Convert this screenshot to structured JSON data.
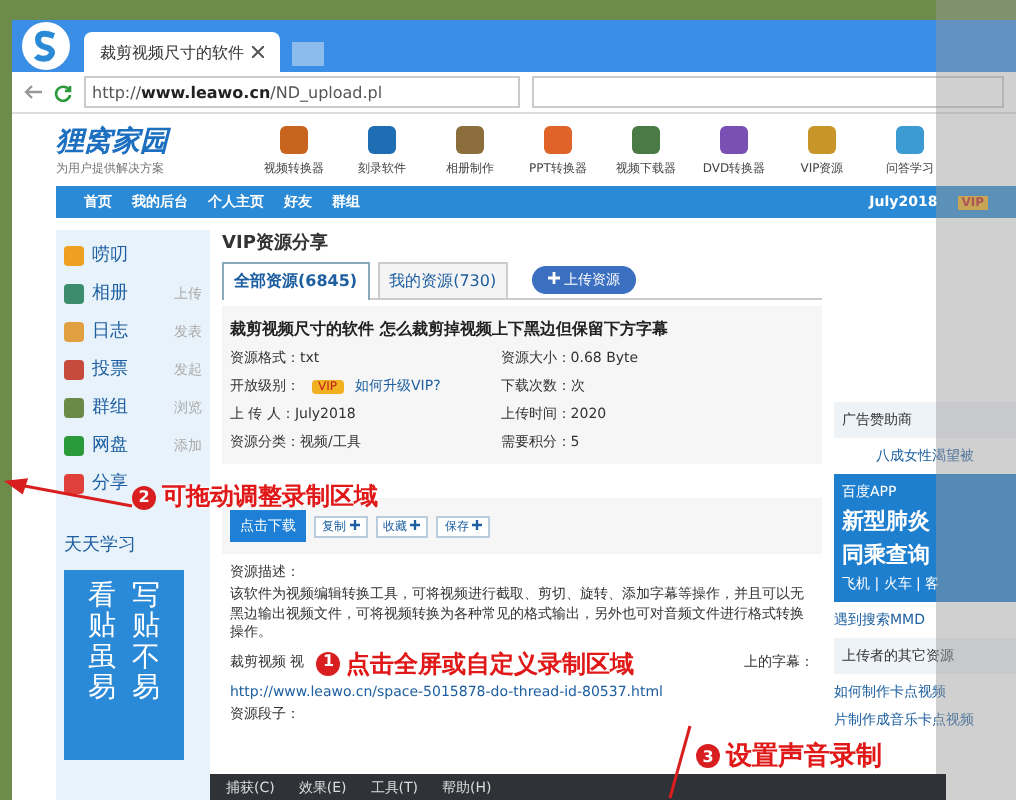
{
  "browser": {
    "tab_title": "裁剪视频尺寸的软件",
    "url_prefix": "http://",
    "url_domain": "www.leawo.cn",
    "url_path": "/ND_upload.pl"
  },
  "site": {
    "logo_title": "狸窝家园",
    "logo_tagline": "为用户提供解决方案",
    "nav_icons": [
      {
        "label": "视频转换器",
        "color": "#c8641e"
      },
      {
        "label": "刻录软件",
        "color": "#1e6eb4"
      },
      {
        "label": "相册制作",
        "color": "#8c6e3c"
      },
      {
        "label": "PPT转换器",
        "color": "#e0642a"
      },
      {
        "label": "视频下载器",
        "color": "#4a7a46"
      },
      {
        "label": "DVD转换器",
        "color": "#7a50b4"
      },
      {
        "label": "VIP资源",
        "color": "#c89628"
      },
      {
        "label": "问答学习",
        "color": "#3c9ad2"
      }
    ]
  },
  "menu": {
    "items": [
      "首页",
      "我的后台",
      "个人主页",
      "好友",
      "群组"
    ],
    "user": "July2018",
    "badge": "VIP"
  },
  "sidebar": {
    "items": [
      {
        "label": "唠叨",
        "color": "#f0a020"
      },
      {
        "label": "相册",
        "action": "上传",
        "color": "#3c8c6e"
      },
      {
        "label": "日志",
        "action": "发表",
        "color": "#e0a040"
      },
      {
        "label": "投票",
        "action": "发起",
        "color": "#c84a3c"
      },
      {
        "label": "群组",
        "action": "浏览",
        "color": "#6a8a4a"
      },
      {
        "label": "网盘",
        "action": "添加",
        "color": "#2a9a3a"
      },
      {
        "label": "分享",
        "color": "#e0403a"
      }
    ],
    "study": "天天学习",
    "banner_columns": [
      "看贴虽易",
      "写贴不易"
    ]
  },
  "main": {
    "title": "VIP资源分享",
    "tabs": [
      {
        "label": "全部资源(6845)",
        "selected": true
      },
      {
        "label": "我的资源(730)",
        "selected": false
      }
    ],
    "upload_button": "上传资源",
    "article_title": "裁剪视频尺寸的软件 怎么裁剪掉视频上下黑边但保留下方字幕",
    "info_left": [
      "资源格式：txt",
      "开放级别：",
      "上 传 人：July2018",
      "资源分类：视频/工具"
    ],
    "vip_badge": "VIP",
    "vip_link": "如何升级VIP?",
    "info_right": [
      "资源大小：0.68 Byte",
      "下载次数：次",
      "上传时间：2020",
      "需要积分：5"
    ],
    "download_button": "点击下载",
    "actions": [
      "复制",
      "收藏",
      "保存"
    ],
    "description_label": "资源描述：",
    "description": "该软件为视频编辑转换工具，可将视频进行截取、剪切、旋转、添加字幕等操作，并且可以无黑边输出视频文件，可将视频转换为各种常见的格式输出，另外也可对音频文件进行格式转换操作。",
    "tutorial_prefix": "裁剪视频 视",
    "tutorial_suffix": "上的字幕：",
    "tutorial_link": "http://www.leawo.cn/space-5015878-do-thread-id-80537.html",
    "excerpt_label": "资源段子："
  },
  "right": {
    "ad_heading": "广告赞助商",
    "ad_title": "八成女性渴望被",
    "ad_lines": [
      "百度APP",
      "新型肺炎",
      "同乘查询",
      "飞机 | 火车 | 客"
    ],
    "ad_link": "遇到搜索MMD",
    "uploader_heading": "上传者的其它资源",
    "uploader_links": [
      "如何制作卡点视频",
      "片制作成音乐卡点视频"
    ]
  },
  "toolbar": {
    "menus": [
      "捕获(C)",
      "效果(E)",
      "工具(T)",
      "帮助(H)"
    ]
  },
  "annotations": [
    {
      "number": "1",
      "text": "点击全屏或自定义录制区域"
    },
    {
      "number": "2",
      "text": "可拖动调整录制区域"
    },
    {
      "number": "3",
      "text": "设置声音录制"
    }
  ]
}
